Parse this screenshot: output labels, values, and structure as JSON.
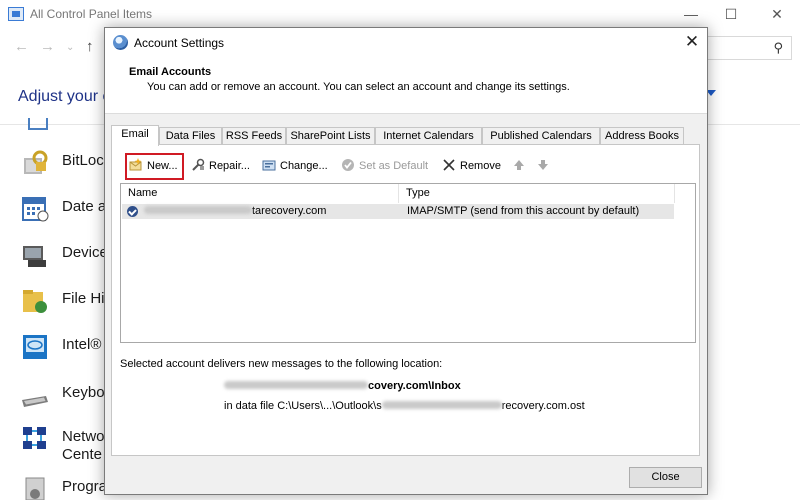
{
  "background_window": {
    "title": "All Control Panel Items",
    "heading": "Adjust your c",
    "items": [
      {
        "label": "BitLoc",
        "icon": "bitlocker-icon"
      },
      {
        "label": "Date a",
        "icon": "calendar-icon"
      },
      {
        "label": "Device",
        "icon": "devices-icon"
      },
      {
        "label": "File Hi",
        "icon": "file-history-icon"
      },
      {
        "label": "Intel®",
        "icon": "intel-graphics-icon"
      },
      {
        "label": "Keybo",
        "icon": "keyboard-icon"
      },
      {
        "label": "Netwo",
        "label2": "Cente",
        "icon": "network-icon"
      },
      {
        "label": "Progra",
        "icon": "programs-icon"
      }
    ]
  },
  "dialog": {
    "title": "Account Settings",
    "header_title": "Email Accounts",
    "header_subtitle": "You can add or remove an account. You can select an account and change its settings.",
    "tabs": [
      "Email",
      "Data Files",
      "RSS Feeds",
      "SharePoint Lists",
      "Internet Calendars",
      "Published Calendars",
      "Address Books"
    ],
    "active_tab": "Email",
    "toolbar": {
      "new": "New...",
      "repair": "Repair...",
      "change": "Change...",
      "set_default": "Set as Default",
      "remove": "Remove"
    },
    "list": {
      "columns": [
        "Name",
        "Type"
      ],
      "rows": [
        {
          "name_suffix": "tarecovery.com",
          "type": "IMAP/SMTP (send from this account by default)"
        }
      ]
    },
    "deliver_label": "Selected account delivers new messages to the following location:",
    "deliver_folder_suffix": "covery.com\\Inbox",
    "deliver_file_prefix": "in data file C:\\Users\\...\\Outlook\\s",
    "deliver_file_suffix": "recovery.com.ost",
    "close_label": "Close"
  },
  "colors": {
    "accent": "#1e3287",
    "highlight_box": "#d01a24",
    "selected_row": "#e6e6e6"
  }
}
